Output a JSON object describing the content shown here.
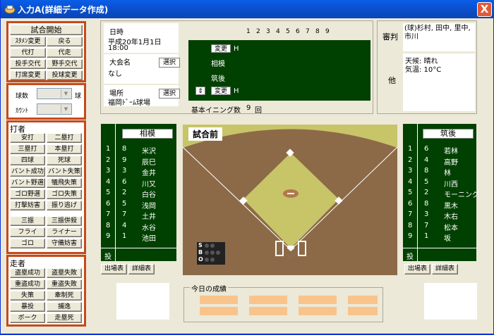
{
  "window": {
    "title": "入力A(詳細データ作成)",
    "close": "X"
  },
  "left": {
    "buttons1": [
      "試合開始",
      "ｽﾀﾒﾝ変更",
      "戻る",
      "代打",
      "代走",
      "投手交代",
      "野手交代",
      "打席変更",
      "投球変更"
    ],
    "pitches_label": "球数",
    "pitches_unit": "球",
    "count_label": "ｶｳﾝﾄ",
    "batter_title": "打者",
    "batter_buttons": [
      "安打",
      "二塁打",
      "三塁打",
      "本塁打",
      "四球",
      "死球",
      "バント成功",
      "バント失策",
      "バント野選",
      "犠飛失策",
      "ゴロ野選",
      "ゴロ失策",
      "打撃妨害",
      "振り逃げ",
      "三振",
      "三振併殺",
      "フライ",
      "ライナー",
      "ゴロ",
      "守備妨害"
    ],
    "runner_title": "走者",
    "runner_buttons": [
      "盗塁成功",
      "盗塁失敗",
      "重盗成功",
      "重盗失敗",
      "失策",
      "牽制死",
      "暴投",
      "捕逸",
      "ボーク",
      "走塁死"
    ]
  },
  "info": {
    "datetime_label": "日時",
    "datetime_line1": "平成20年1月1日",
    "datetime_line2": "18:00",
    "tournament_label": "大会名",
    "tournament_value": "なし",
    "select1": "選択",
    "place_label": "場所",
    "place_value": "福岡ﾄﾞｰﾑ球場",
    "select2": "選択",
    "innings": [
      "1",
      "2",
      "3",
      "4",
      "5",
      "6",
      "7",
      "8",
      "9"
    ],
    "change1": "変更",
    "h1": "H",
    "team_top": "相模",
    "team_bottom": "筑後",
    "swap": "⇕",
    "change2": "変更",
    "h2": "H",
    "innings_label": "基本イニング数",
    "innings_value": "9",
    "innings_unit": "回"
  },
  "umpires": {
    "label": "審判",
    "value": "(球)杉村, 田中, 里中, 市川",
    "other_label": "他",
    "weather": "天候: 晴れ",
    "temp": "気温: 10°C"
  },
  "home_lineup": {
    "team": "相模",
    "rows": [
      {
        "order": "1",
        "pos": "8",
        "name": "米沢"
      },
      {
        "order": "2",
        "pos": "9",
        "name": "辰巳"
      },
      {
        "order": "3",
        "pos": "3",
        "name": "金井"
      },
      {
        "order": "4",
        "pos": "6",
        "name": "川又"
      },
      {
        "order": "5",
        "pos": "2",
        "name": "白谷"
      },
      {
        "order": "6",
        "pos": "5",
        "name": "浅岡"
      },
      {
        "order": "7",
        "pos": "7",
        "name": "土井"
      },
      {
        "order": "8",
        "pos": "4",
        "name": "水谷"
      },
      {
        "order": "9",
        "pos": "1",
        "name": "池田"
      }
    ],
    "pitcher_label": "投",
    "btn_roster": "出場表",
    "btn_detail": "詳細表"
  },
  "away_lineup": {
    "team": "筑後",
    "rows": [
      {
        "order": "1",
        "pos": "6",
        "name": "若林"
      },
      {
        "order": "2",
        "pos": "4",
        "name": "高野"
      },
      {
        "order": "3",
        "pos": "8",
        "name": "林"
      },
      {
        "order": "4",
        "pos": "5",
        "name": "川西"
      },
      {
        "order": "5",
        "pos": "2",
        "name": "モーニング"
      },
      {
        "order": "6",
        "pos": "8",
        "name": "黒木"
      },
      {
        "order": "7",
        "pos": "3",
        "name": "木右"
      },
      {
        "order": "8",
        "pos": "7",
        "name": "松本"
      },
      {
        "order": "9",
        "pos": "1",
        "name": "坂"
      }
    ],
    "pitcher_label": "投",
    "btn_roster": "出場表",
    "btn_detail": "詳細表"
  },
  "field": {
    "status": "試合前",
    "sbo": [
      "S",
      "B",
      "O"
    ]
  },
  "results": {
    "label": "今日の成績"
  },
  "colors": {
    "panel_orange": "#c44a1c",
    "scoreboard_green": "#004000",
    "field_grass": "#c8c468",
    "infield_dirt": "#8c6a48"
  }
}
